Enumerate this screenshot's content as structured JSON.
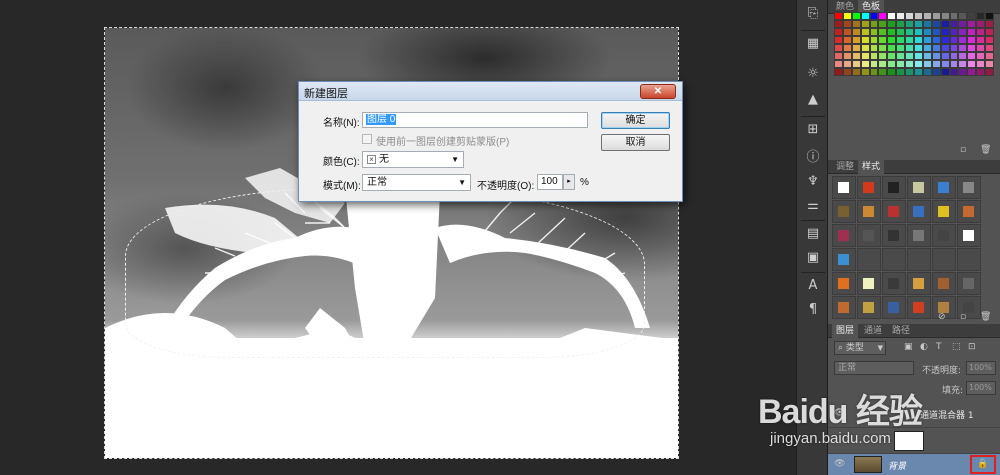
{
  "dialog": {
    "title": "新建图层",
    "name_label": "名称(N):",
    "name_value": "图层 0",
    "clip_checkbox_label": "使用前一图层创建剪贴蒙版(P)",
    "color_label": "颜色(C):",
    "color_value": "无",
    "mode_label": "模式(M):",
    "mode_value": "正常",
    "opacity_label": "不透明度(O):",
    "opacity_value": "100",
    "opacity_unit": "%",
    "ok_label": "确定",
    "cancel_label": "取消",
    "close_icon": "close-icon"
  },
  "swatches_panel": {
    "tabs": [
      {
        "label": "颜色"
      },
      {
        "label": "色板"
      }
    ]
  },
  "styles_panel": {
    "tabs": [
      {
        "label": "调整"
      },
      {
        "label": "样式"
      }
    ]
  },
  "layers_panel": {
    "tabs": [
      {
        "label": "图层"
      },
      {
        "label": "通道"
      },
      {
        "label": "路径"
      }
    ],
    "filter_label": "类型",
    "blend_mode": "正常",
    "opacity_label": "不透明度:",
    "opacity_value": "100%",
    "fill_label": "填充:",
    "fill_value": "100%",
    "layers": [
      {
        "name": "通道混合器 1"
      },
      {
        "name": "背景"
      }
    ]
  },
  "watermark": {
    "brand": "Baidu 经验",
    "url": "jingyan.baidu.com"
  },
  "colors": {
    "dialog_bg": "#f0f0f0",
    "panel_bg": "#535353",
    "workspace_bg": "#282828",
    "highlight_red": "#e02020"
  }
}
